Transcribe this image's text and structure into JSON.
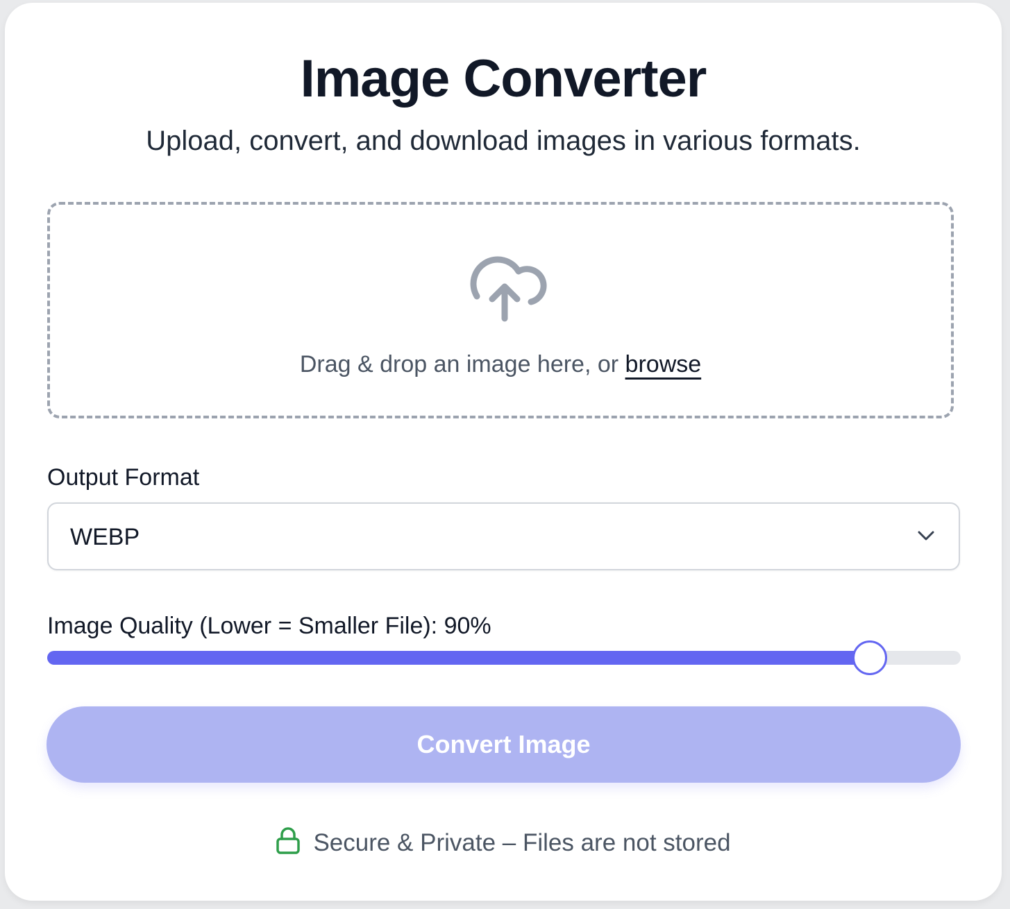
{
  "header": {
    "title": "Image Converter",
    "subtitle": "Upload, convert, and download images in various formats."
  },
  "dropzone": {
    "icon": "cloud-upload-icon",
    "text": "Drag & drop an image here, or ",
    "browse_label": "browse"
  },
  "format": {
    "label": "Output Format",
    "selected": "WEBP"
  },
  "quality": {
    "label": "Image Quality (Lower = Smaller File): 90%",
    "value_percent": 90
  },
  "convert": {
    "label": "Convert Image",
    "enabled": false
  },
  "footer": {
    "icon": "lock-icon",
    "text": "Secure & Private – Files are not stored"
  },
  "colors": {
    "accent": "#6366f1",
    "button_disabled": "#aeb4f2",
    "lock": "#2e9e4a",
    "title": "#111827"
  }
}
